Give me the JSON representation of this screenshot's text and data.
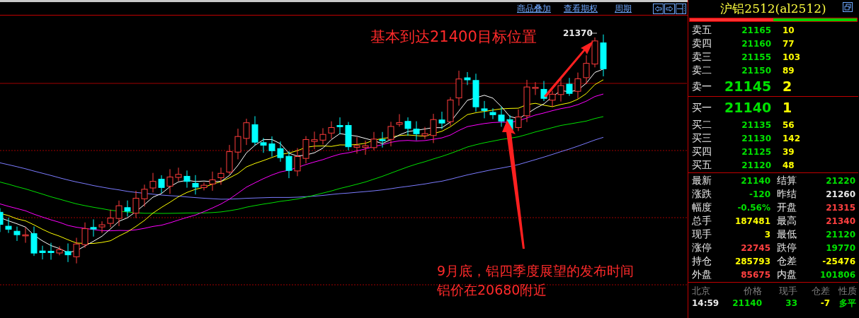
{
  "chart_toolbar": {
    "links": [
      "商品叠加",
      "查看期权",
      "周期"
    ]
  },
  "chart": {
    "high_label": "21370",
    "annotations": [
      {
        "kind": "top",
        "text": "基本到达21400目标位置"
      },
      {
        "kind": "bottom",
        "lines": [
          "9月底，铝四季度展望的发布时间",
          "铝价在20680附近"
        ]
      }
    ]
  },
  "quote_panel": {
    "title": "沪铝2512(al2512)",
    "ratio_bar": {
      "level": 0.5
    },
    "asks": [
      {
        "label": "卖五",
        "price": "21165",
        "volume": "10",
        "big": false
      },
      {
        "label": "卖四",
        "price": "21160",
        "volume": "77",
        "big": false
      },
      {
        "label": "卖三",
        "price": "21155",
        "volume": "103",
        "big": false
      },
      {
        "label": "卖二",
        "price": "21150",
        "volume": "89",
        "big": false
      },
      {
        "label": "卖一",
        "price": "21145",
        "volume": "2",
        "big": true
      }
    ],
    "bids": [
      {
        "label": "买一",
        "price": "21140",
        "volume": "1",
        "big": true
      },
      {
        "label": "买二",
        "price": "21135",
        "volume": "56",
        "big": false
      },
      {
        "label": "买三",
        "price": "21130",
        "volume": "142",
        "big": false
      },
      {
        "label": "买四",
        "price": "21125",
        "volume": "39",
        "big": false
      },
      {
        "label": "买五",
        "price": "21120",
        "volume": "48",
        "big": false
      }
    ],
    "stats": [
      {
        "label": "最新",
        "value": "21140",
        "color": "#00e000"
      },
      {
        "label": "结算",
        "value": "21220",
        "color": "#00e000"
      },
      {
        "label": "涨跌",
        "value": "-120",
        "color": "#00e000"
      },
      {
        "label": "昨结",
        "value": "21260",
        "color": "#e8e8e8"
      },
      {
        "label": "幅度",
        "value": "-0.56%",
        "color": "#00e000"
      },
      {
        "label": "开盘",
        "value": "21315",
        "color": "#ff4040"
      },
      {
        "label": "总手",
        "value": "187481",
        "color": "#ffff00"
      },
      {
        "label": "最高",
        "value": "21340",
        "color": "#ff4040"
      },
      {
        "label": "现手",
        "value": "3",
        "color": "#ffff00"
      },
      {
        "label": "最低",
        "value": "21120",
        "color": "#00e000"
      },
      {
        "label": "涨停",
        "value": "22745",
        "color": "#ff4040"
      },
      {
        "label": "跌停",
        "value": "19770",
        "color": "#00e000"
      },
      {
        "label": "持仓",
        "value": "285793",
        "color": "#ffff00"
      },
      {
        "label": "仓差",
        "value": "-25476",
        "color": "#ffff00"
      },
      {
        "label": "外盘",
        "value": "85675",
        "color": "#ff4040"
      },
      {
        "label": "内盘",
        "value": "101806",
        "color": "#00e000"
      }
    ],
    "ticks_header": [
      "北京",
      "价格",
      "现手",
      "仓差",
      "性质"
    ],
    "ticks": [
      {
        "time": "14:59",
        "price": "21140",
        "volume": "33",
        "oi_change": "-7",
        "nature": "多平"
      }
    ]
  }
}
